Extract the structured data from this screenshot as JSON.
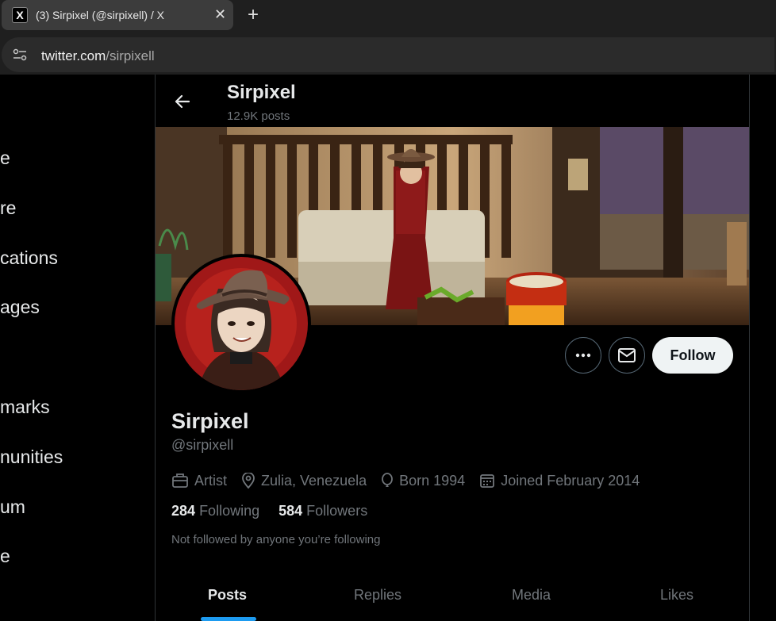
{
  "browser": {
    "tab_title": "(3) Sirpixel (@sirpixell) / X",
    "favicon": "X",
    "close_glyph": "✕",
    "newtab_glyph": "+",
    "url_host": "twitter.com",
    "url_path": "/sirpixell"
  },
  "nav": {
    "items": [
      "e",
      "re",
      "cations",
      "ages",
      "marks",
      "nunities",
      "um",
      "e"
    ]
  },
  "header": {
    "name": "Sirpixel",
    "posts": "12.9K posts"
  },
  "profile": {
    "name": "Sirpixel",
    "handle": "@sirpixell",
    "occupation": "Artist",
    "location": "Zulia, Venezuela",
    "born": "Born 1994",
    "joined": "Joined February 2014",
    "following_count": "284",
    "following_label": "Following",
    "followers_count": "584",
    "followers_label": "Followers",
    "followed_by": "Not followed by anyone you’re following",
    "follow_label": "Follow"
  },
  "tabs": [
    "Posts",
    "Replies",
    "Media",
    "Likes"
  ],
  "colors": {
    "accent": "#1d9bf0",
    "background": "#000000",
    "muted_text": "#71767b",
    "follow_button_bg": "#eff3f4"
  }
}
